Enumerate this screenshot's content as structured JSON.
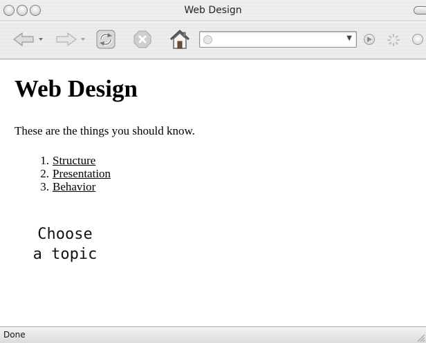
{
  "window": {
    "title": "Web Design"
  },
  "toolbar": {
    "back_icon": "back-arrow-icon",
    "forward_icon": "forward-arrow-icon",
    "reload_icon": "reload-icon",
    "stop_icon": "stop-icon",
    "home_icon": "home-icon",
    "url_value": "",
    "go_icon": "go-arrow-icon",
    "throbber_icon": "loading-throbber-icon",
    "search_icon": "search-engine-icon"
  },
  "page": {
    "heading": "Web Design",
    "intro": "These are the things you should know.",
    "topics": [
      {
        "number": "1.",
        "label": "Structure"
      },
      {
        "number": "2.",
        "label": "Presentation"
      },
      {
        "number": "3.",
        "label": "Behavior"
      }
    ],
    "prompt_line1": "Choose",
    "prompt_line2": "a topic"
  },
  "status": {
    "text": "Done"
  },
  "colors": {
    "link": "#000000",
    "chrome_light": "#f2f2f2",
    "chrome_dark": "#e4e4e4"
  }
}
